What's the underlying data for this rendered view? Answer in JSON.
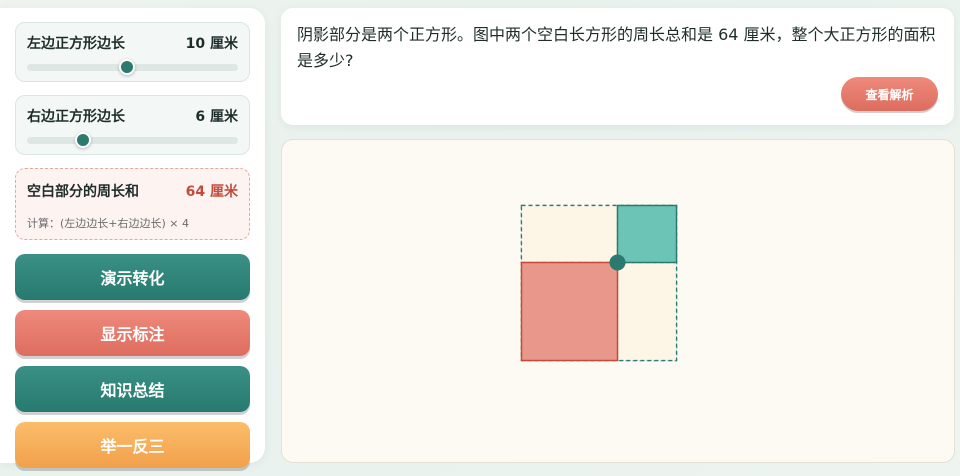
{
  "left_slider": {
    "label": "左边正方形边长",
    "value_text": "10 厘米",
    "value": 10,
    "min": 1,
    "max": 20
  },
  "right_slider": {
    "label": "右边正方形边长",
    "value_text": "6 厘米",
    "value": 6,
    "min": 1,
    "max": 20
  },
  "perimeter": {
    "label": "空白部分的周长和",
    "value_text": "64 厘米",
    "formula": "计算：(左边边长+右边边长) × 4"
  },
  "buttons": {
    "demo": "演示转化",
    "labels": "显示标注",
    "summary": "知识总结",
    "extend": "举一反三"
  },
  "question": {
    "text": "阴影部分是两个正方形。图中两个空白长方形的周长总和是 64 厘米，整个大正方形的面积是多少?",
    "analysis_button": "查看解析"
  },
  "figure": {
    "big_square": 10,
    "small_square": 6
  },
  "colors": {
    "teal": "#2a7a70",
    "coral": "#e8978a",
    "small_square": "#6cc4b6",
    "blank": "#fdf6e6",
    "accent_red": "#c44b3c"
  }
}
